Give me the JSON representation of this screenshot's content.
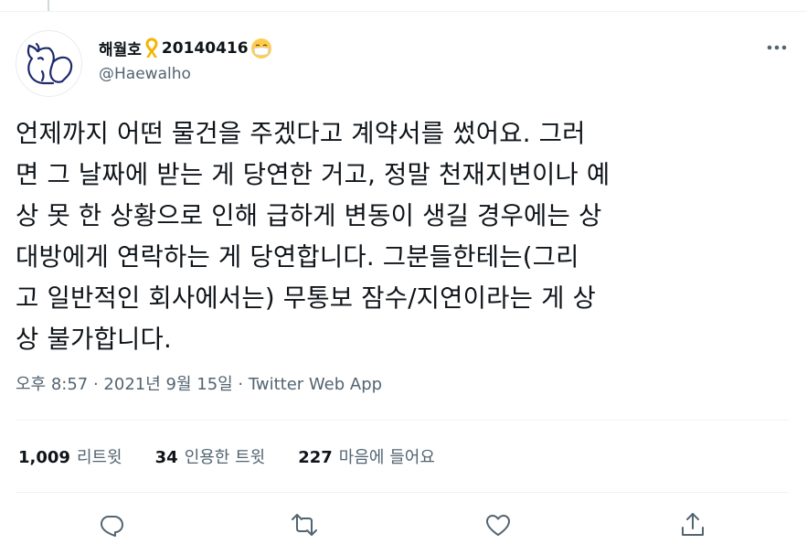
{
  "tweet": {
    "author": {
      "display_name": "해월호",
      "display_suffix": "20140416",
      "handle": "@Haewalho"
    },
    "text": "언제까지 어떤 물건을 주겠다고 계약서를 썼어요. 그러\n면 그 날짜에 받는 게 당연한 거고, 정말 천재지변이나 예\n상 못 한 상황으로 인해 급하게 변동이 생길 경우에는 상\n대방에게 연락하는 게 당연합니다. 그분들한테는(그리\n고 일반적인 회사에서는) 무통보 잠수/지연이라는 게 상\n상 불가합니다.",
    "meta": "오후 8:57 · 2021년 9월 15일 · Twitter Web App",
    "stats": [
      {
        "count": "1,009",
        "label": "리트윗"
      },
      {
        "count": "34",
        "label": "인용한 트윗"
      },
      {
        "count": "227",
        "label": "마음에 들어요"
      }
    ]
  },
  "colors": {
    "text_primary": "#0f1419",
    "text_secondary": "#536471",
    "divider": "#eff3f4",
    "ribbon": "#f4b400"
  },
  "icons": [
    "more-icon",
    "reply-icon",
    "retweet-icon",
    "like-icon",
    "share-icon"
  ]
}
